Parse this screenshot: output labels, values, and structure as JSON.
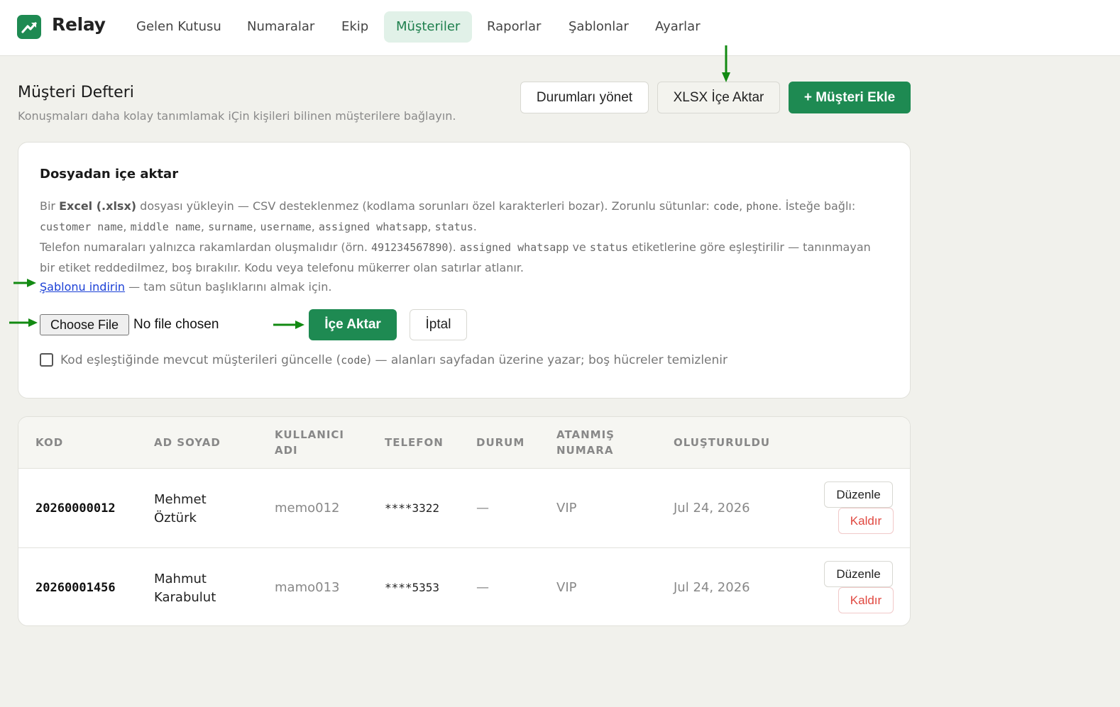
{
  "app": {
    "name": "Relay"
  },
  "nav": [
    {
      "label": "Gelen Kutusu",
      "active": false
    },
    {
      "label": "Numaralar",
      "active": false
    },
    {
      "label": "Ekip",
      "active": false
    },
    {
      "label": "Müşteriler",
      "active": true
    },
    {
      "label": "Raporlar",
      "active": false
    },
    {
      "label": "Şablonlar",
      "active": false
    },
    {
      "label": "Ayarlar",
      "active": false
    }
  ],
  "header": {
    "title": "Müşteri Defteri",
    "subtitle": "Konuşmaları daha kolay tanımlamak iÇin kişileri bilinen müşterilere bağlayın.",
    "manage_statuses": "Durumları yönet",
    "import_xlsx": "XLSX İçe Aktar",
    "add_customer": "+ Müşteri Ekle"
  },
  "import_card": {
    "title": "Dosyadan içe aktar",
    "line1_pre": "Bir ",
    "line1_bold": "Excel (.xlsx)",
    "line1_post": " dosyası yükleyin — CSV desteklenmez (kodlama sorunları özel karakterleri bozar). Zorunlu sütunlar: ",
    "req_code": "code",
    "comma": ", ",
    "req_phone": "phone",
    "line1_end": ". İsteğe bağlı:",
    "opt_customer_name": "customer name",
    "opt_middle_name": "middle name",
    "opt_surname": "surname",
    "opt_username": "username",
    "opt_assigned_whatsapp": "assigned whatsapp",
    "opt_status": "status",
    "period": ".",
    "line3_pre": "Telefon numaraları yalnızca rakamlardan oluşmalıdır (örn. ",
    "example_phone": "491234567890",
    "line3_mid1": "). ",
    "match_assigned": "assigned whatsapp",
    "line3_ve": " ve ",
    "match_status": "status",
    "line3_post": " etiketlerine göre eşleştirilir — tanınmayan",
    "line4": "bir etiket reddedilmez, boş bırakılır. Kodu veya telefonu mükerrer olan satırlar atlanır.",
    "template_link": "Şablonu indirin",
    "template_suffix": " — tam sütun başlıklarını almak için.",
    "choose_file": "Choose File",
    "no_file": "No file chosen",
    "import_button": "İçe Aktar",
    "cancel_button": "İptal",
    "update_pre": "Kod eşleştiğinde mevcut müşterileri güncelle (",
    "update_code": "code",
    "update_post": ") — alanları sayfadan üzerine yazar; boş hücreler temizlenir"
  },
  "table": {
    "columns": [
      "KOD",
      "AD SOYAD",
      "KULLANICI ADI",
      "TELEFON",
      "DURUM",
      "ATANMIŞ NUMARA",
      "OLUŞTURULDU"
    ],
    "col_kullanici_1": "KULLANICI",
    "col_kullanici_2": "ADI",
    "col_atanmis_1": "ATANMIŞ",
    "col_atanmis_2": "NUMARA",
    "rows": [
      {
        "code": "20260000012",
        "first": "Mehmet",
        "last": "Öztürk",
        "username": "memo012",
        "phone": "****3322",
        "status": "—",
        "assigned": "VIP",
        "created": "Jul 24, 2026",
        "edit": "Düzenle",
        "remove": "Kaldır"
      },
      {
        "code": "20260001456",
        "first": "Mahmut",
        "last": "Karabulut",
        "username": "mamo013",
        "phone": "****5353",
        "status": "—",
        "assigned": "VIP",
        "created": "Jul 24, 2026",
        "edit": "Düzenle",
        "remove": "Kaldır"
      }
    ]
  },
  "colors": {
    "brand": "#1e8a52",
    "danger": "#e0473f",
    "link": "#1a3fd6",
    "annotation_arrow": "#128a12"
  }
}
